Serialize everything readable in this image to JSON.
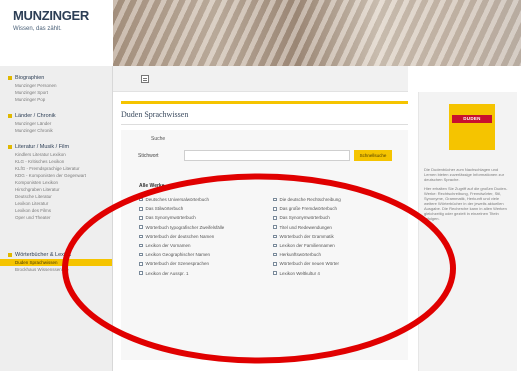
{
  "header": {
    "logo_text": "MUNZINGER",
    "tagline": "Wissen, das zählt."
  },
  "sidebar": {
    "sections": [
      {
        "title": "Biographien",
        "items": [
          "Munzinger Personen",
          "Munzinger Sport",
          "Munzinger Pop"
        ]
      },
      {
        "title": "Länder / Chronik",
        "items": [
          "Munzinger Länder",
          "Munzinger Chronik"
        ]
      },
      {
        "title": "Literatur / Musik / Film",
        "items": [
          "Kindlers Literatur Lexikon",
          "KLG - Kritisches Lexikon",
          "KLfG - Fremdsprachige Literatur",
          "KDG - Komponisten der Gegenwart",
          "Komponisten Lexikon",
          "Hirschgraben Literatur",
          "Deutsche Literatur",
          "Lexikon Literatur",
          "Lexikon des Films",
          "Oper und Theater"
        ]
      },
      {
        "title": "Wörterbücher & Lexika",
        "items": [
          "Duden Sprachwissen",
          "Brockhaus Wissensservice"
        ]
      }
    ],
    "active_item": "Duden Sprachwissen"
  },
  "main": {
    "page_title": "Duden Sprachwissen",
    "search_heading": "Suche",
    "search_label": "Stichwort",
    "search_value": "",
    "search_button": "Schnellsuche",
    "all_label": "Alle Werke",
    "dictionaries_left": [
      "Deutsches Universalwörterbuch",
      "Das Stilwörterbuch",
      "Das Synonymwörterbuch",
      "Wörterbuch typografischer Zweifelsfälle",
      "Wörterbuch der deutschen Namen",
      "Lexikon der Vornamen",
      "Lexikon Geographischer Namen",
      "Wörterbuch der Szenesprachen",
      "Lexikon der Ausspr. 1"
    ],
    "dictionaries_right": [
      "Die deutsche Rechtschreibung",
      "Das große Fremdwörterbuch",
      "Das Synonymwörterbuch",
      "Titel und Redewendungen",
      "Wörterbuch der Grammatik",
      "Lexikon der Familiennamen",
      "Herkunftswörterbuch",
      "Wörterbuch der neuen Wörter",
      "Lexikon Weltkultur 4"
    ]
  },
  "right_panel": {
    "logo_text": "DUDEN",
    "paragraphs": [
      "Die Dudenbücher zum Nachschlagen und Lernen bieten zuverlässige Informationen zur deutschen Sprache.",
      "Hier erhalten Sie Zugriff auf die großen Duden-Werke: Rechtschreibung, Fremdwörter, Stil, Synonyme, Grammatik, Herkunft und viele weitere Wörterbücher in der jeweils aktuellen Ausgabe. Die Recherche kann in allen Werken gleichzeitig oder gezielt in einzelnen Titeln erfolgen."
    ]
  },
  "colors": {
    "accent": "#f5c400",
    "annotation": "#e00000",
    "brand_blue": "#2c3e55"
  }
}
